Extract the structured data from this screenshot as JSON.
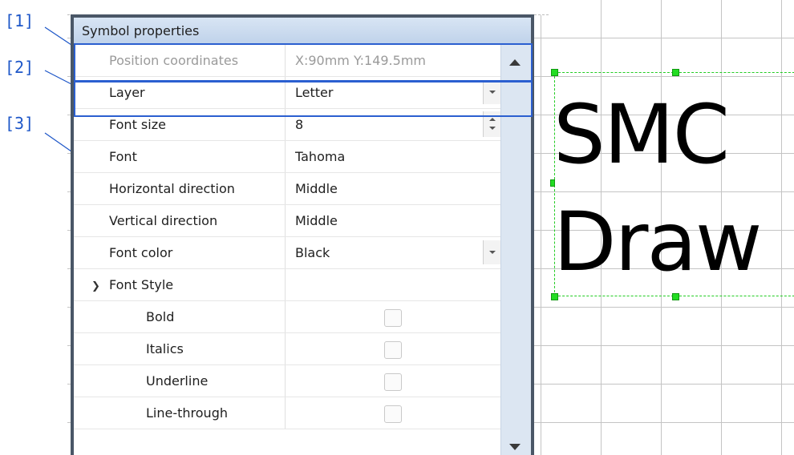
{
  "callouts": [
    "[1]",
    "[2]",
    "[3]"
  ],
  "panel": {
    "title": "Symbol properties",
    "rows": [
      {
        "name": "Position coordinates",
        "value": "X:90mm Y:149.5mm",
        "disabled": true
      },
      {
        "name": "Layer",
        "value": "Letter",
        "control": "dropdown"
      },
      {
        "name": "Font size",
        "value": "8",
        "control": "spinner"
      },
      {
        "name": "Font",
        "value": "Tahoma"
      },
      {
        "name": "Horizontal direction",
        "value": "Middle"
      },
      {
        "name": "Vertical direction",
        "value": "Middle"
      },
      {
        "name": "Font color",
        "value": "Black",
        "control": "dropdown"
      },
      {
        "name": "Font Style",
        "value": "",
        "group": true
      },
      {
        "name": "Bold",
        "checked": false
      },
      {
        "name": "Italics",
        "checked": false
      },
      {
        "name": "Underline",
        "checked": false
      },
      {
        "name": "Line-through",
        "checked": false
      }
    ]
  },
  "canvas": {
    "line1": "SMC",
    "line2": "Draw"
  },
  "colors": {
    "callout": "#1d56c8",
    "selection": "#22cc22",
    "panel_frame": "#4a5767"
  },
  "icons": {
    "group_toggle": "chevron-down-icon",
    "scroll_up": "scroll-up-arrow-icon",
    "scroll_down": "scroll-down-arrow-icon"
  }
}
